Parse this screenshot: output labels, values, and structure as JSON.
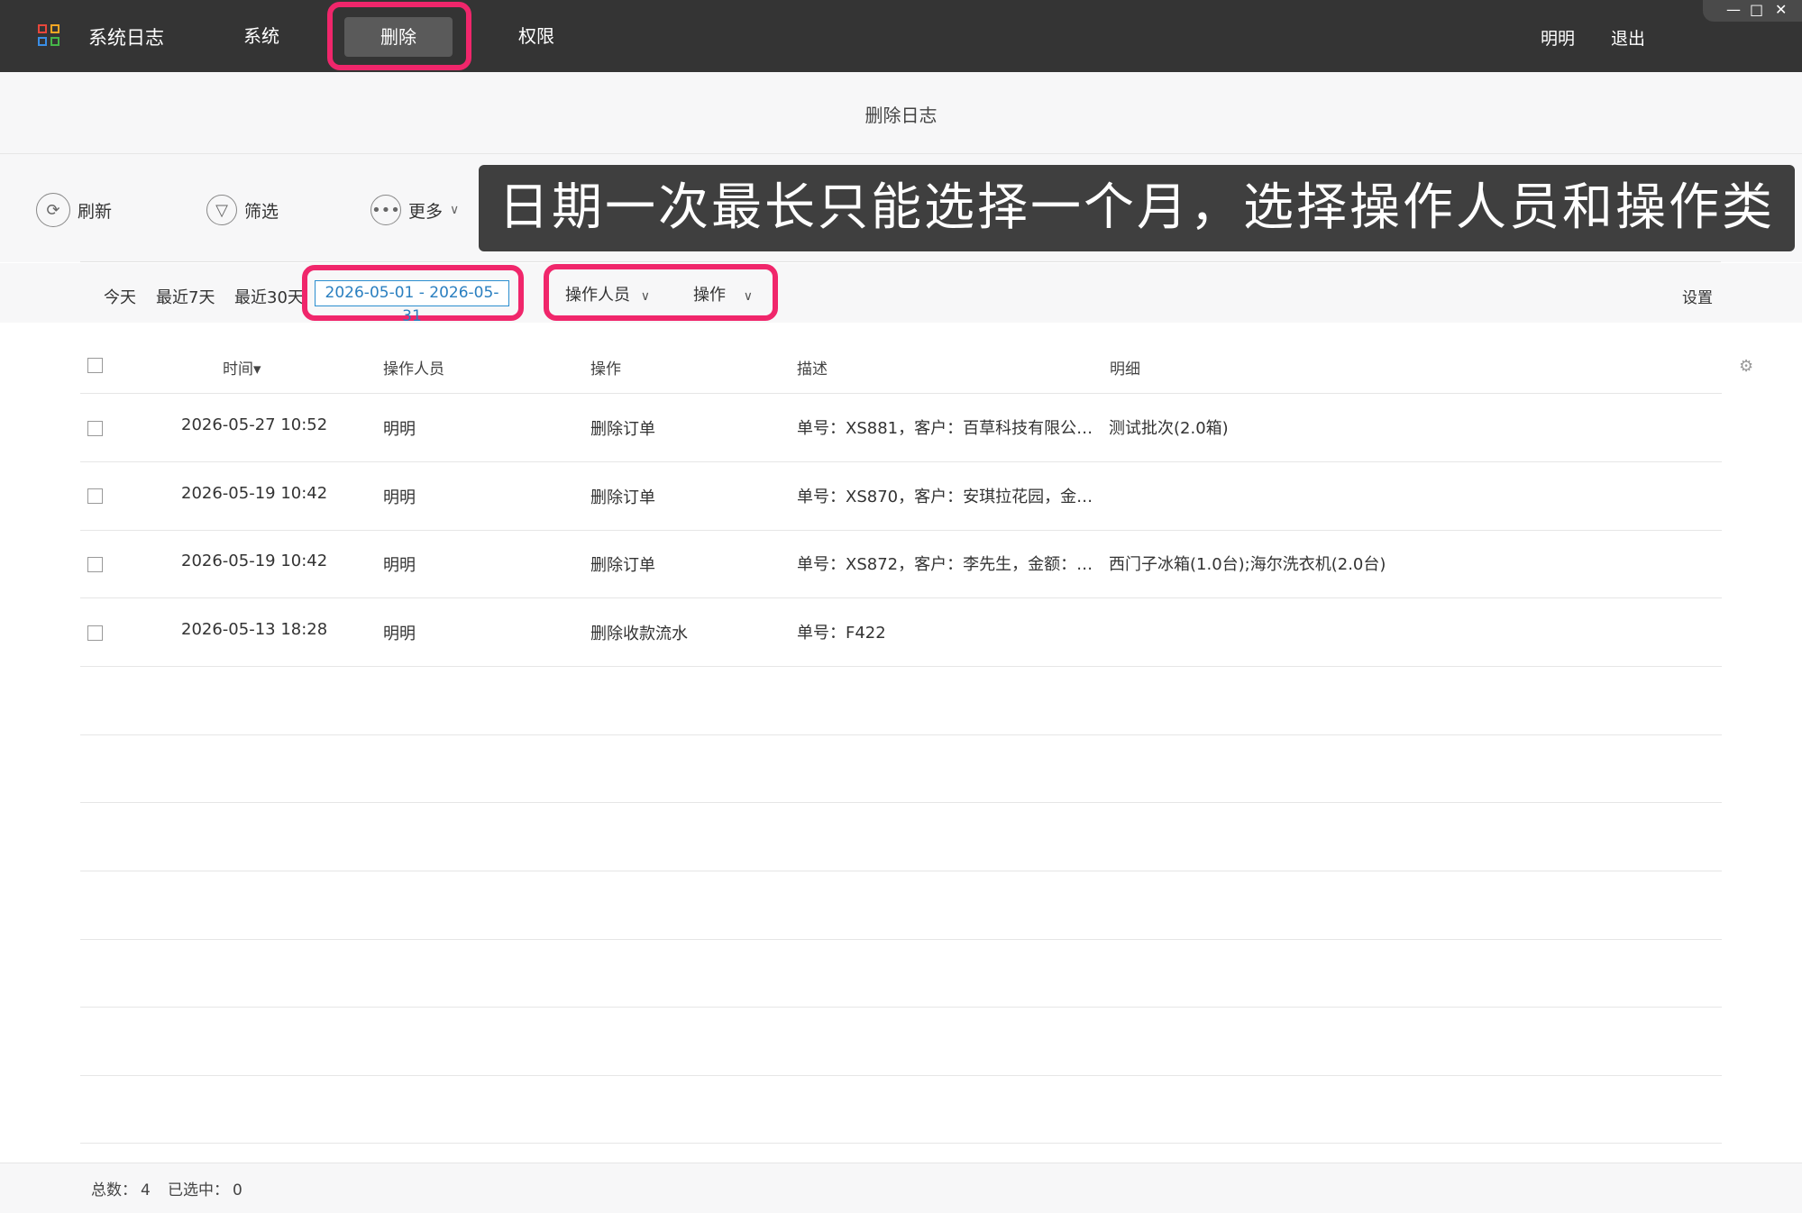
{
  "app": {
    "title": "系统日志"
  },
  "nav": {
    "system": "系统",
    "delete": "删除",
    "permissions": "权限"
  },
  "user": {
    "name": "明明",
    "logout": "退出"
  },
  "window": {
    "minimize": "—",
    "maximize": "□",
    "close": "✕"
  },
  "page": {
    "title": "删除日志"
  },
  "toolbar": {
    "refresh": "刷新",
    "filter": "筛选",
    "more": "更多"
  },
  "banner": "日期一次最长只能选择一个月，选择操作人员和操作类型",
  "filters": {
    "today": "今天",
    "last7": "最近7天",
    "last30": "最近30天",
    "date_range": "2026-05-01 - 2026-05-31",
    "operator": "操作人员",
    "operation": "操作",
    "settings": "设置"
  },
  "table": {
    "columns": [
      "时间▾",
      "操作人员",
      "操作",
      "描述",
      "明细"
    ],
    "rows": [
      [
        "2026-05-27 10:52",
        "明明",
        "删除订单",
        "单号：XS881，客户：百草科技有限公…",
        "测试批次(2.0箱)"
      ],
      [
        "2026-05-19 10:42",
        "明明",
        "删除订单",
        "单号：XS870，客户：安琪拉花园，金…",
        ""
      ],
      [
        "2026-05-19 10:42",
        "明明",
        "删除订单",
        "单号：XS872，客户：李先生，金额：…",
        "西门子冰箱(1.0台);海尔洗衣机(2.0台)"
      ],
      [
        "2026-05-13 18:28",
        "明明",
        "删除收款流水",
        "单号：F422",
        ""
      ]
    ]
  },
  "footer": {
    "total_label": "总数：",
    "total": "4",
    "selected_label": "已选中：",
    "selected": "0"
  },
  "colors": {
    "highlight": "#f0266b",
    "topbar": "#343434",
    "link": "#2a7fc0"
  }
}
